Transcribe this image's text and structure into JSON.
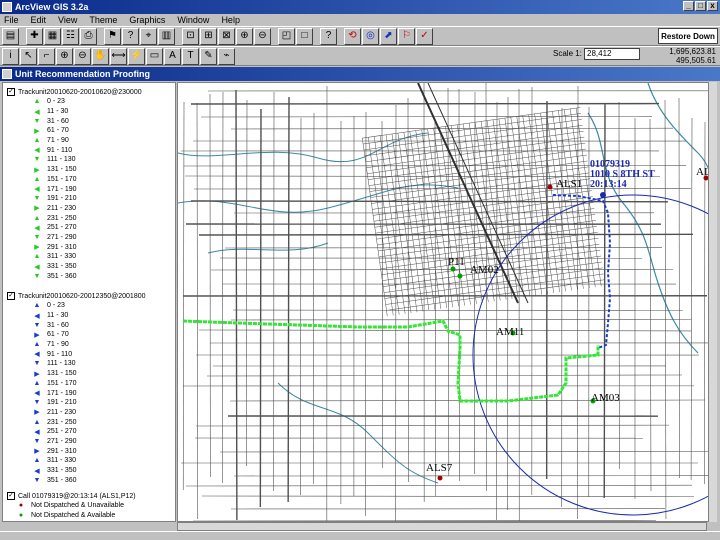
{
  "window": {
    "title": "ArcView GIS 3.2a",
    "min": "_",
    "max": "□",
    "close": "x"
  },
  "menus": [
    "File",
    "Edit",
    "View",
    "Theme",
    "Graphics",
    "Window",
    "Help"
  ],
  "toolbar": {
    "helpline_label": "Restore Down"
  },
  "scale": {
    "label": "Scale 1:",
    "value": "28,412"
  },
  "coords": {
    "x": "1,695,623.81",
    "y": "495,505.61"
  },
  "view": {
    "title": "Unit Recommendation Proofing"
  },
  "themes": [
    {
      "name": "Trackunit20010620-20010620@230000",
      "checked": true,
      "symbol_color": "#22cc22",
      "ranges": [
        "0 - 23",
        "11 - 30",
        "31 - 60",
        "61 - 70",
        "71 - 90",
        "91 - 110",
        "111 - 130",
        "131 - 150",
        "151 - 170",
        "171 - 190",
        "191 - 210",
        "211 - 230",
        "231 - 250",
        "251 - 270",
        "271 - 290",
        "291 - 310",
        "311 - 330",
        "331 - 350",
        "351 - 360"
      ]
    },
    {
      "name": "Trackunit20010620-20012350@2001800",
      "checked": true,
      "symbol_color": "#1a3bd0",
      "ranges": [
        "0 - 23",
        "11 - 30",
        "31 - 60",
        "61 - 70",
        "71 - 90",
        "91 - 110",
        "111 - 130",
        "131 - 150",
        "151 - 170",
        "171 - 190",
        "191 - 210",
        "211 - 230",
        "231 - 250",
        "251 - 270",
        "271 - 290",
        "291 - 310",
        "311 - 330",
        "331 - 350",
        "351 - 360"
      ]
    },
    {
      "name": "Call 01079319@20:13:14 (ALS1,P12)",
      "checked": true,
      "items": [
        {
          "label": "Not Dispatched & Unavailable",
          "color": "#a00000"
        },
        {
          "label": "Not Dispatched & Available",
          "color": "#00a000"
        }
      ]
    }
  ],
  "map": {
    "units": [
      {
        "id": "ALS1",
        "label": "ALS1"
      },
      {
        "id": "ALS2",
        "label": "ALS"
      },
      {
        "id": "P11",
        "label": "P11"
      },
      {
        "id": "AM02",
        "label": "AM02"
      },
      {
        "id": "AM11",
        "label": "AM11"
      },
      {
        "id": "AM03",
        "label": "AM03"
      },
      {
        "id": "ALS7",
        "label": "ALS7"
      }
    ],
    "incident": {
      "line1": "01079319",
      "line2": "1010 S 8TH ST",
      "line3": "20:13:14"
    },
    "colors": {
      "green_track": "#33e633",
      "blue_track": "#1a3bd0",
      "streets": "#505050",
      "water": "#3a8aa8",
      "circle": "#1a2ab0"
    }
  }
}
